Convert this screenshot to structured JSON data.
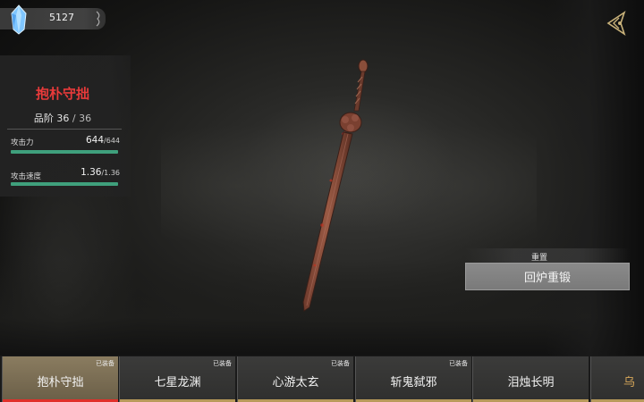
{
  "currency": {
    "icon": "crystal-icon",
    "value": "5127"
  },
  "back_button": {
    "icon": "back-icon"
  },
  "stats": {
    "weapon_name": "抱朴守拙",
    "grade_label": "品阶",
    "grade_value": "36",
    "grade_sep": "/",
    "grade_max": "36",
    "attack_label": "攻击力",
    "attack_value": "644",
    "attack_max": "/644",
    "attack_fraction": 1.0,
    "speed_label": "攻击速度",
    "speed_value": "1.36",
    "speed_max": "/1.36",
    "speed_fraction": 1.0
  },
  "reset": {
    "label": "重置",
    "button_label": "回炉重锻"
  },
  "tabs": [
    {
      "name": "抱朴守拙",
      "badge": "已装备",
      "active": true
    },
    {
      "name": "七星龙渊",
      "badge": "已装备",
      "active": false
    },
    {
      "name": "心游太玄",
      "badge": "已装备",
      "active": false
    },
    {
      "name": "斩鬼弑邪",
      "badge": "已装备",
      "active": false
    },
    {
      "name": "泪烛长明",
      "badge": "",
      "active": false
    },
    {
      "name": "乌",
      "badge": "",
      "active": false
    }
  ],
  "colors": {
    "accent_red": "#e0302a",
    "bar_green": "#3fa07c",
    "gold": "#b89a5a"
  }
}
